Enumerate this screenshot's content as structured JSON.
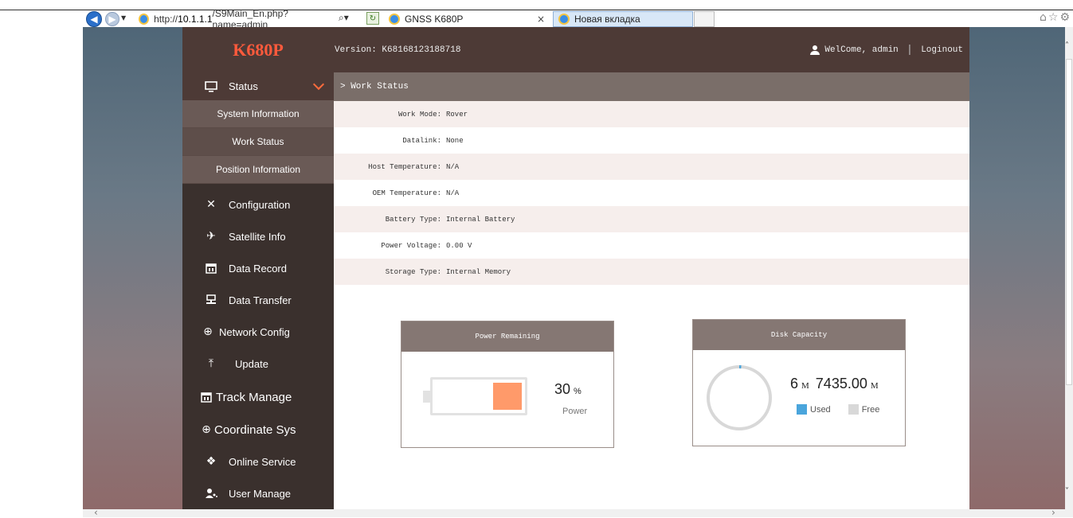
{
  "browser": {
    "address": "http://10.1.1.1/S9Main_En.php?name=admin",
    "address_host": "10.1.1.1",
    "address_prefix": "http://",
    "address_path": "/S9Main_En.php?name=admin",
    "tabs": [
      {
        "label": "GNSS K680P",
        "close": "×"
      },
      {
        "label": "Новая вкладка"
      }
    ]
  },
  "header": {
    "logo": "K680P",
    "version": "Version: K68168123188718",
    "welcome": "WelCome, admin",
    "separator": "|",
    "logout": "Loginout"
  },
  "sidebar": {
    "status_label": "Status",
    "sub_items": [
      "System Information",
      "Work Status",
      "Position Information"
    ],
    "items": [
      {
        "label": "Configuration",
        "icon": "tools-icon"
      },
      {
        "label": "Satellite Info",
        "icon": "satellite-icon"
      },
      {
        "label": "Data Record",
        "icon": "calendar-icon"
      },
      {
        "label": "Data Transfer",
        "icon": "network-icon"
      },
      {
        "label": "Network Config",
        "icon": "globe-icon"
      },
      {
        "label": "Update",
        "icon": "upload-icon"
      },
      {
        "label": "Track Manage",
        "icon": "calendar-icon"
      },
      {
        "label": "Coordinate Sys",
        "icon": "globe-icon"
      },
      {
        "label": "Online Service",
        "icon": "cube-icon"
      },
      {
        "label": "User Manage",
        "icon": "users-icon"
      }
    ]
  },
  "content": {
    "breadcrumb": "> Work Status",
    "status_rows": [
      {
        "key": "Work Mode:",
        "value": "Rover"
      },
      {
        "key": "Datalink:",
        "value": "None"
      },
      {
        "key": "Host Temperature:",
        "value": "N/A"
      },
      {
        "key": "OEM Temperature:",
        "value": "N/A"
      },
      {
        "key": "Battery Type:",
        "value": "Internal Battery"
      },
      {
        "key": "Power Voltage:",
        "value": "0.00 V"
      },
      {
        "key": "Storage Type:",
        "value": "Internal Memory"
      }
    ],
    "power": {
      "title": "Power Remaining",
      "value": "30",
      "unit": "%",
      "label": "Power",
      "fill_fraction": 0.3,
      "fill_color": "#ff9a6a"
    },
    "disk": {
      "title": "Disk Capacity",
      "used_value": "6",
      "used_unit": "M",
      "free_value": "7435.00",
      "free_unit": "M",
      "used_label": "Used",
      "free_label": "Free",
      "used_fraction": 0.0008,
      "used_color": "#4aa5dc",
      "free_color": "#d8d8d8"
    }
  }
}
